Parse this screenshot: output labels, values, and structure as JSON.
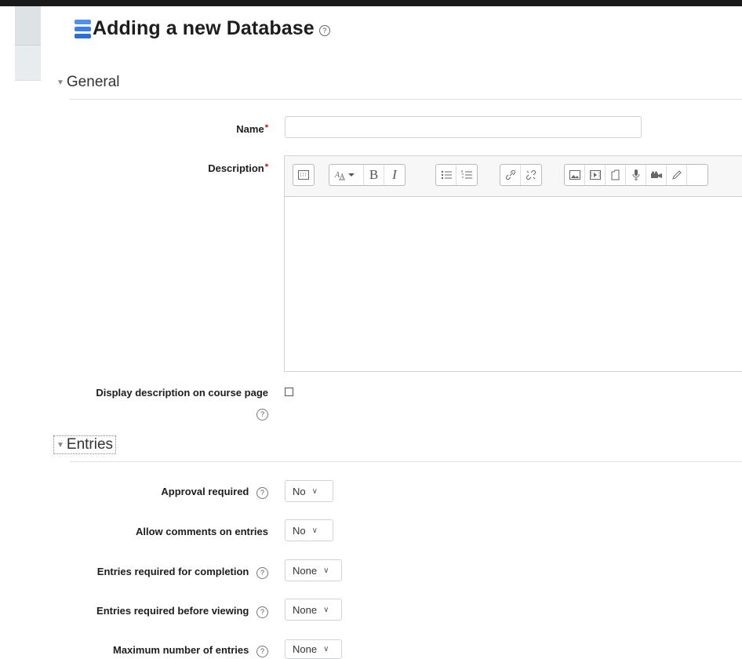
{
  "page": {
    "title": "Adding a new Database",
    "help_glyph": "?"
  },
  "sections": {
    "general": "General",
    "entries": "Entries"
  },
  "fields": {
    "name_label": "Name",
    "name_value": "",
    "description_label": "Description",
    "required_marker": "*",
    "display_description_label": "Display description on course page",
    "approval_label": "Approval required",
    "approval_value": "No",
    "comments_label": "Allow comments on entries",
    "comments_value": "No",
    "completion_label": "Entries required for completion",
    "completion_value": "None",
    "viewing_label": "Entries required before viewing",
    "viewing_value": "None",
    "max_entries_label": "Maximum number of entries",
    "max_entries_value": "None"
  },
  "editor": {
    "toolbar": {
      "bold": "B",
      "italic": "I"
    }
  },
  "icons": {
    "caret": "▼",
    "chevron": "∨"
  }
}
